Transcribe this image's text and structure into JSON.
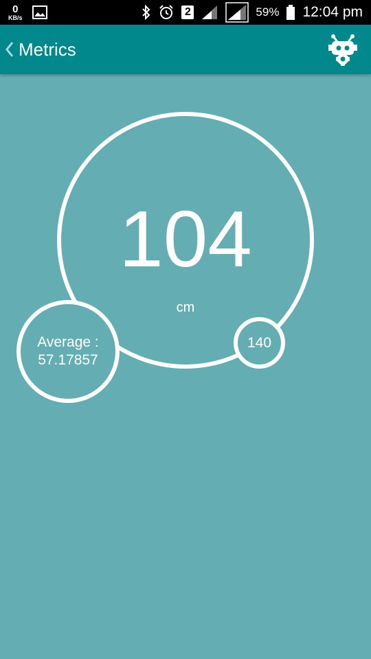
{
  "status_bar": {
    "net_speed_value": "0",
    "net_speed_unit": "KB/s",
    "sim_slot": "2",
    "battery": "59%",
    "time": "12:04 pm",
    "icons": [
      "image-icon",
      "bluetooth-icon",
      "alarm-icon",
      "signal-icon",
      "battery-icon"
    ]
  },
  "app_bar": {
    "title": "Metrics",
    "back_icon": "chevron-left-icon",
    "action_icon": "robot-gear-icon",
    "color": "#00888c"
  },
  "metrics": {
    "value": "104",
    "unit": "cm",
    "average_label": "Average :",
    "average_value": "57.17857",
    "max_value": "140",
    "background": "#64aeb3"
  }
}
